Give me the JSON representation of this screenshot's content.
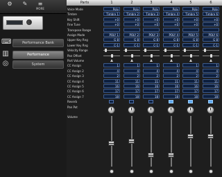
{
  "toolbar": {
    "buttons": [
      {
        "glyph": "⚙"
      },
      {
        "glyph": "✎"
      },
      {
        "glyph": "≡",
        "label": "MORE"
      }
    ]
  },
  "sidebar": {
    "items": [
      {
        "label": "Performance Bank",
        "icon": "keyboard-icon",
        "selected": false
      },
      {
        "label": "Performance",
        "icon": "piano-icon",
        "selected": true
      },
      {
        "label": "System",
        "icon": "globe-icon",
        "selected": false
      }
    ]
  },
  "parts_header": {
    "title": "Parts",
    "columns": [
      "1",
      "2",
      "3",
      "4",
      "5",
      "6"
    ]
  },
  "rows": {
    "voice_mode": {
      "label": "Voice Mode",
      "values": [
        "Poly",
        "Poly",
        "Poly",
        "Poly",
        "Poly",
        "Poly"
      ]
    },
    "timbre": {
      "label": "Timbre",
      "values": [
        "Timbre 1",
        "Timbre 2",
        "Timbre 3",
        "Timbre 4",
        "Timbre 5",
        "Timbre 6"
      ]
    },
    "key_shift": {
      "label": "Key Shift",
      "values": [
        "+0",
        "+0",
        "+0",
        "+0",
        "+0",
        "+0"
      ]
    },
    "fine_tune": {
      "label": "Fine Tune",
      "values": [
        "+0",
        "+0",
        "+0",
        "+0",
        "+0",
        "+0"
      ]
    },
    "transpose_range": {
      "label": "Transpose Range",
      "values": [
        "",
        "",
        "",
        "",
        "",
        ""
      ]
    },
    "assign_mode": {
      "label": "Assign Mode",
      "values": [
        "POLY 1",
        "POLY 2",
        "POLY 3",
        "POLY 4",
        "POLY 5",
        "POLY 6"
      ]
    },
    "upper_key_rng": {
      "label": "Upper Key Rng",
      "values": [
        "G 8",
        "G 8",
        "G 8",
        "G 8",
        "G 8",
        "G 8"
      ]
    },
    "lower_key_rng": {
      "label": "Lower Key Rng",
      "values": [
        "C-1",
        "C-1",
        "C-1",
        "C-1",
        "C-1",
        "C-1"
      ]
    },
    "velocity_range": {
      "label": "Velocity Range",
      "values": []
    },
    "pan_offset": {
      "label": "Pan Offset",
      "values": []
    },
    "part_volume": {
      "label": "Part Volume",
      "values": []
    },
    "cc1": {
      "label": "CC Assign",
      "values": [
        "1",
        "1",
        "1",
        "1",
        "1",
        "1"
      ]
    },
    "cc2": {
      "label": "CC Assign 2",
      "values": [
        "4",
        "4",
        "4",
        "4",
        "4",
        "4"
      ]
    },
    "cc3": {
      "label": "CC Assign 3",
      "values": [
        "2",
        "2",
        "2",
        "2",
        "2",
        "2"
      ]
    },
    "cc4": {
      "label": "CC Assign 4",
      "values": [
        "11",
        "11",
        "11",
        "11",
        "11",
        "11"
      ]
    },
    "cc5": {
      "label": "CC Assign 5",
      "values": [
        "16",
        "16",
        "16",
        "16",
        "16",
        "16"
      ]
    },
    "cc6": {
      "label": "CC Assign 6",
      "values": [
        "17",
        "17",
        "17",
        "17",
        "17",
        "17"
      ]
    },
    "cc7": {
      "label": "CC Assign 7",
      "values": [
        "18",
        "18",
        "18",
        "18",
        "18",
        "18"
      ]
    },
    "reverb": {
      "label": "Reverb",
      "values": []
    },
    "pan_pot": {
      "label": "Pan Pot",
      "values": []
    },
    "volume": {
      "label": "Volume",
      "values": []
    }
  },
  "reverb_states": [
    false,
    false,
    false,
    true,
    true,
    true
  ],
  "fader_levels": [
    0.45,
    0.5,
    0.2,
    0.2,
    0.6,
    0.6
  ],
  "colors": {
    "field_bg": "#0d1f3e",
    "field_border": "#3d5a8a",
    "check_on": "#5da7f0"
  }
}
